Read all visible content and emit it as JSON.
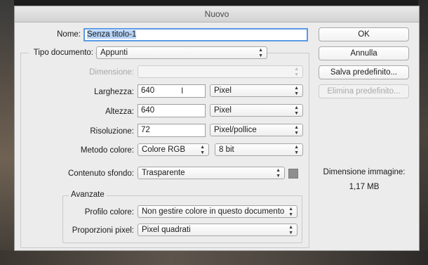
{
  "window": {
    "title": "Nuovo"
  },
  "form": {
    "name_label": "Nome:",
    "name_value": "Senza titolo-1",
    "doc_type_label": "Tipo documento:",
    "doc_type_value": "Appunti",
    "dimension_label": "Dimensione:",
    "dimension_value": "",
    "width_label": "Larghezza:",
    "width_value": "640",
    "width_unit": "Pixel",
    "height_label": "Altezza:",
    "height_value": "640",
    "height_unit": "Pixel",
    "resolution_label": "Risoluzione:",
    "resolution_value": "72",
    "resolution_unit": "Pixel/pollice",
    "color_mode_label": "Metodo colore:",
    "color_mode_value": "Colore RGB",
    "bit_depth_value": "8 bit",
    "background_label": "Contenuto sfondo:",
    "background_value": "Trasparente",
    "background_swatch_color": "#8e8e8e"
  },
  "advanced": {
    "title": "Avanzate",
    "color_profile_label": "Profilo colore:",
    "color_profile_value": "Non gestire colore in questo documento",
    "pixel_aspect_label": "Proporzioni pixel:",
    "pixel_aspect_value": "Pixel quadrati"
  },
  "buttons": {
    "ok": "OK",
    "cancel": "Annulla",
    "save_preset": "Salva predefinito...",
    "delete_preset": "Elimina predefinito..."
  },
  "image_size": {
    "label": "Dimensione immagine:",
    "value": "1,17 MB"
  },
  "colors": {
    "focus_ring": "#5a9ae6",
    "selection": "#b4d2f6"
  }
}
